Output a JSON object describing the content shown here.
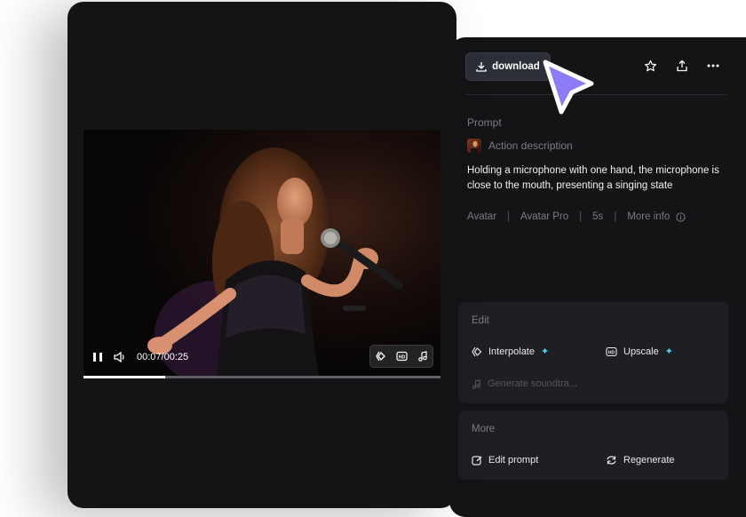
{
  "player": {
    "current_time": "00:07",
    "duration": "00:25",
    "time_display": "00:07/00:25",
    "progress": 0.23
  },
  "toolbar": {
    "download_label": "download"
  },
  "details": {
    "prompt_label": "Prompt",
    "action_label": "Action description",
    "prompt_text": "Holding a microphone with one hand, the microphone is close to the mouth, presenting a singing state",
    "meta": [
      "Avatar",
      "Avatar Pro",
      "5s",
      "More info"
    ]
  },
  "edit": {
    "title": "Edit",
    "interpolate_label": "Interpolate",
    "upscale_label": "Upscale",
    "soundtrack_label": "Generate soundtra..."
  },
  "more": {
    "title": "More",
    "edit_prompt_label": "Edit prompt",
    "regenerate_label": "Regenerate"
  },
  "colors": {
    "panel": "#141417",
    "card": "#1e1f24",
    "accent_cursor": "#8b7cf6",
    "sparkle": "#4fd3e8"
  }
}
